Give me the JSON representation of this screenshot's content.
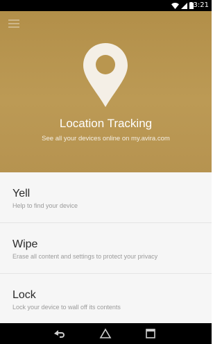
{
  "status_bar": {
    "time": "13:21",
    "icons": [
      "wifi-icon",
      "signal-icon",
      "battery-icon"
    ]
  },
  "header": {
    "menu_icon": "hamburger-menu-icon",
    "hero_icon": "location-pin-icon",
    "title": "Location Tracking",
    "subtitle": "See all your devices online on my.avira.com",
    "background_color": "#b9964f"
  },
  "actions": [
    {
      "title": "Yell",
      "description": "Help to find your device"
    },
    {
      "title": "Wipe",
      "description": "Erase all content and settings to protect your privacy"
    },
    {
      "title": "Lock",
      "description": "Lock your device to wall off its contents"
    }
  ],
  "nav_bar": {
    "icons": [
      "back-icon",
      "home-icon",
      "recents-icon"
    ]
  }
}
